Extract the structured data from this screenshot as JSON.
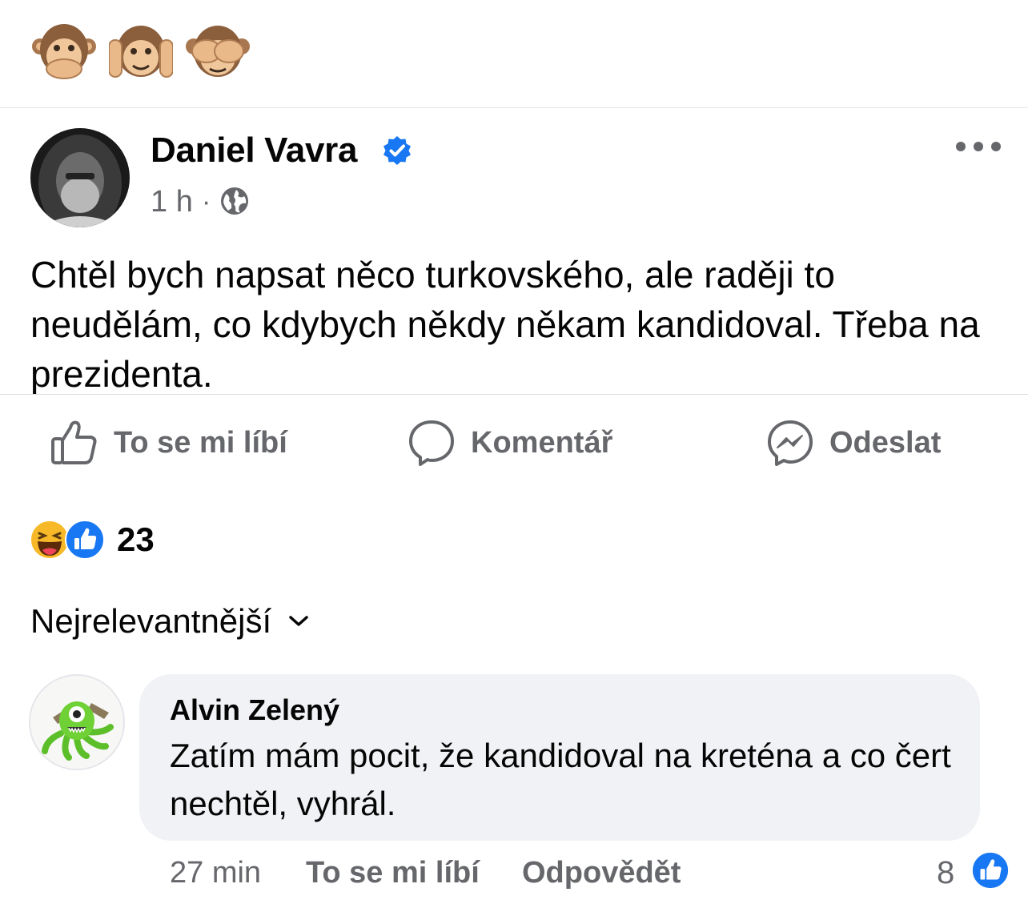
{
  "top_emojis": [
    "speak-no-evil-monkey",
    "hear-no-evil-monkey",
    "see-no-evil-monkey"
  ],
  "post": {
    "author": "Daniel Vavra",
    "verified": true,
    "time": "1 h",
    "separator": "·",
    "audience_icon": "globe-icon",
    "text": "Chtěl bych napsat něco turkovského, ale raději to neudělám, co kdybych někdy někam kandidoval. Třeba na prezidenta."
  },
  "actions": {
    "like": "To se mi líbí",
    "comment": "Komentář",
    "send": "Odeslat"
  },
  "reactions": {
    "icons": [
      "haha-reaction-icon",
      "like-reaction-icon"
    ],
    "count": "23"
  },
  "sort": {
    "label": "Nejrelevantnější"
  },
  "comment": {
    "author": "Alvin Zelený",
    "text": "Zatím mám pocit, že kandidoval na kreténa a co čert nechtěl, vyhrál.",
    "time": "27 min",
    "like_label": "To se mi líbí",
    "reply_label": "Odpovědět",
    "like_count": "8"
  },
  "colors": {
    "facebook_blue": "#1877f2",
    "secondary_text": "#65676b",
    "bubble_bg": "#f0f2f5"
  }
}
